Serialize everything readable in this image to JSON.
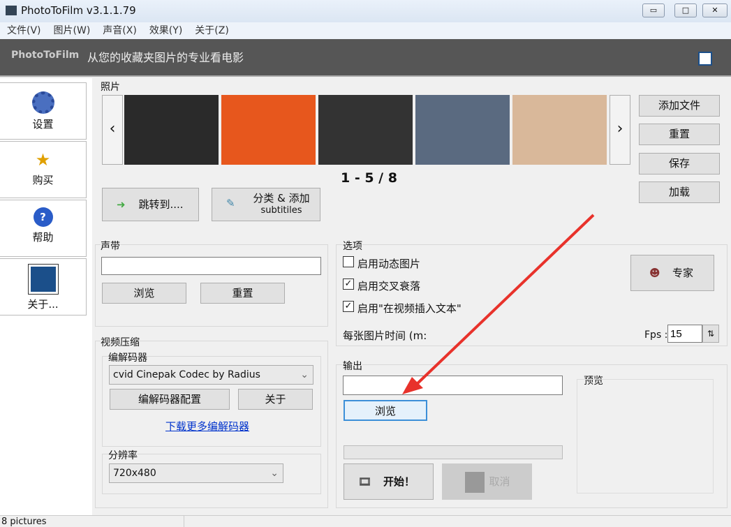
{
  "window": {
    "title": "PhotoToFilm v3.1.1.79",
    "min": "▭",
    "max": "□",
    "close": "✕"
  },
  "menu": [
    "文件(V)",
    "图片(W)",
    "声音(X)",
    "效果(Y)",
    "关于(Z)"
  ],
  "banner": {
    "brand": "PhotoToFilm",
    "tagline": "从您的收藏夹图片的专业看电影"
  },
  "sidebar": [
    {
      "label": "设置",
      "icon": "gear-icon"
    },
    {
      "label": "购买",
      "icon": "cart-icon"
    },
    {
      "label": "帮助",
      "icon": "help-icon"
    },
    {
      "label": "关于...",
      "icon": "logo-icon"
    }
  ],
  "photos": {
    "label": "照片",
    "counter": "1 - 5 / 8",
    "prev": "‹",
    "next": "›",
    "thumb_colors": [
      "#2a2a2a",
      "#e7571d",
      "#333",
      "#5a6a80",
      "#d9b89a"
    ],
    "buttons": [
      "添加文件",
      "重置",
      "保存",
      "加载"
    ],
    "jump": "跳转到....",
    "sort_add": "分类 & 添加",
    "subtitles": "subtitiles"
  },
  "sound": {
    "label": "声带",
    "value": "",
    "browse": "浏览",
    "reset": "重置"
  },
  "options": {
    "label": "选项",
    "checks": [
      {
        "label": "启用动态图片",
        "checked": false
      },
      {
        "label": "启用交叉衰落",
        "checked": true
      },
      {
        "label": "启用\"在视频插入文本\"",
        "checked": true
      }
    ],
    "expert": "专家",
    "time_label": "每张图片时间 (m:",
    "fps_label": "Fps :",
    "fps": "15"
  },
  "video": {
    "label": "视频压缩",
    "codec_label": "编解码器",
    "codec": "cvid Cinepak Codec by Radius",
    "config": "编解码器配置",
    "about": "关于",
    "download": "下载更多编解码器",
    "res_label": "分辨率",
    "res": "720x480"
  },
  "output": {
    "label": "输出",
    "value": "",
    "browse": "浏览",
    "progress": 0,
    "start": "开始！",
    "cancel": "取消",
    "preview": "预览"
  },
  "status": "8 pictures"
}
